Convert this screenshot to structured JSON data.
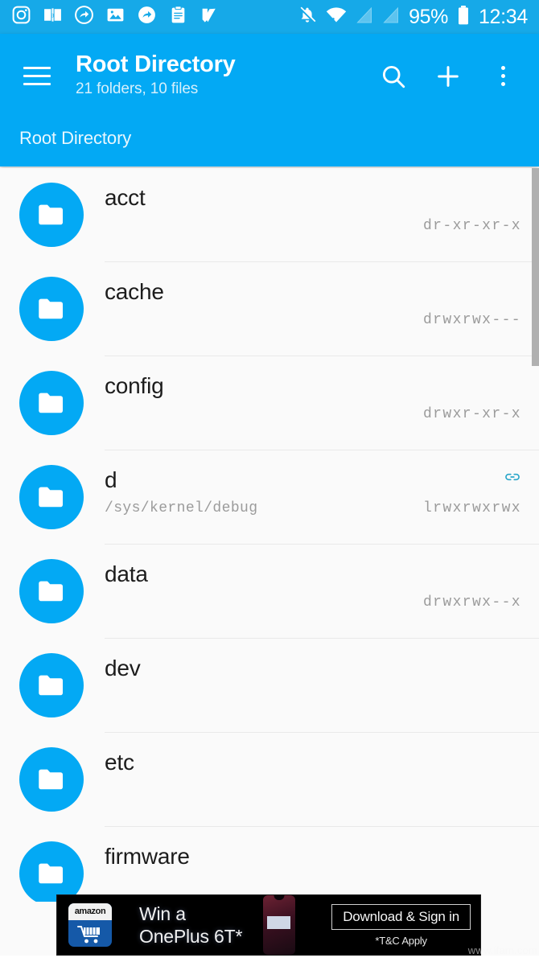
{
  "status_bar": {
    "notification_icons": [
      {
        "name": "instagram-icon"
      },
      {
        "name": "amazon-kindle-icon"
      },
      {
        "name": "share-arrow-circle-icon"
      },
      {
        "name": "gallery-image-icon"
      },
      {
        "name": "share-arrow-circle-icon-2"
      },
      {
        "name": "clipboard-icon"
      },
      {
        "name": "checkmark-badge-icon"
      }
    ],
    "silent_icon": "bell-off-icon",
    "wifi_icon": "wifi-icon",
    "signal_icon_1": "signal-bars-dim-icon",
    "signal_icon_2": "signal-bars-dim-icon-2",
    "battery_percent": "95%",
    "battery_icon": "battery-icon",
    "time": "12:34"
  },
  "app_bar": {
    "menu_icon": "hamburger-menu-icon",
    "title": "Root Directory",
    "subtitle": "21 folders, 10 files",
    "search_icon": "search-icon",
    "add_icon": "plus-icon",
    "overflow_icon": "overflow-menu-icon"
  },
  "breadcrumb": {
    "items": [
      "Root Directory"
    ]
  },
  "file_list": {
    "rows": [
      {
        "name": "acct",
        "icon": "folder-icon",
        "permissions": "dr-xr-xr-x",
        "symlink_target": "",
        "is_symlink": false
      },
      {
        "name": "cache",
        "icon": "folder-icon",
        "permissions": "drwxrwx---",
        "symlink_target": "",
        "is_symlink": false
      },
      {
        "name": "config",
        "icon": "folder-icon",
        "permissions": "drwxr-xr-x",
        "symlink_target": "",
        "is_symlink": false
      },
      {
        "name": "d",
        "icon": "folder-icon",
        "permissions": "lrwxrwxrwx",
        "symlink_target": "/sys/kernel/debug",
        "is_symlink": true
      },
      {
        "name": "data",
        "icon": "folder-icon",
        "permissions": "drwxrwx--x",
        "symlink_target": "",
        "is_symlink": false
      },
      {
        "name": "dev",
        "icon": "folder-icon",
        "permissions": "",
        "symlink_target": "",
        "is_symlink": false
      },
      {
        "name": "etc",
        "icon": "folder-icon",
        "permissions": "",
        "symlink_target": "",
        "is_symlink": false
      },
      {
        "name": "firmware",
        "icon": "folder-icon",
        "permissions": "",
        "symlink_target": "",
        "is_symlink": false
      }
    ],
    "link_icon": "chain-link-icon",
    "scrollbar": "vertical-scrollbar"
  },
  "ad_banner": {
    "brand_icon": "amazon-app-icon",
    "brand_word": "amazon",
    "line1": "Win a",
    "line2": "OnePlus 6T*",
    "phone_image": "oneplus-6t-phone-image",
    "cta_label": "Download & Sign in",
    "disclaimer": "*T&C Apply",
    "watermark": "www.ifam.com"
  },
  "colors": {
    "primary": "#03a9f4",
    "status_bar": "#16a9e8",
    "list_background": "#fafafa",
    "link_accent": "#29a6c9",
    "permission_text": "#9b9b9b"
  }
}
